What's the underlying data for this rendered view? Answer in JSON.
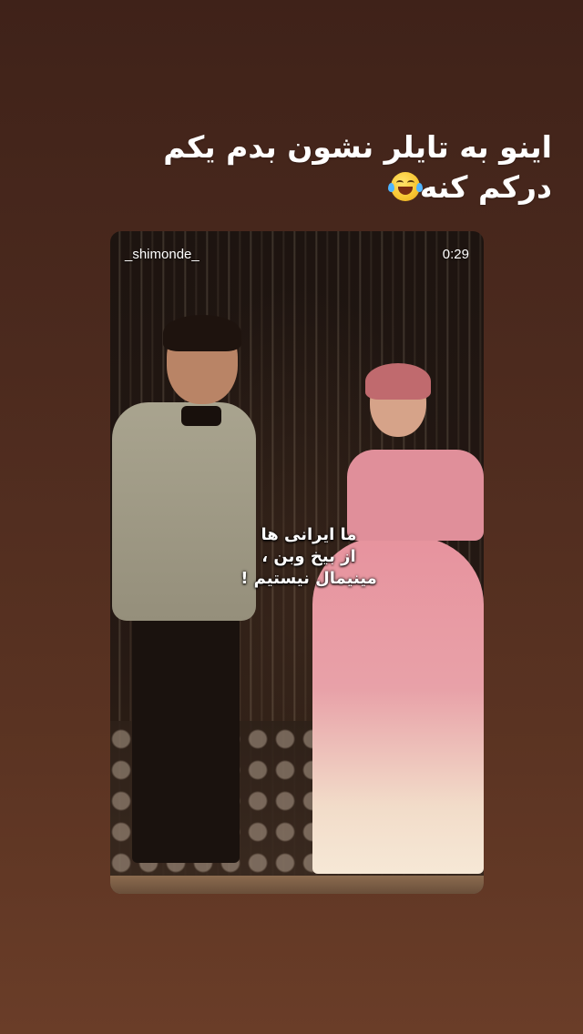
{
  "story": {
    "caption_line1": "اینو به تایلر نشون بدم یکم",
    "caption_line2": "درکم کنه",
    "caption_emoji": "face-with-tears-of-joy-icon"
  },
  "shared_post": {
    "username": "_shimonde_",
    "duration": "0:29",
    "overlay_lines": [
      "ما ایرانی ها",
      "از بیخ وبن ،",
      "مینیمال نیستیم !"
    ]
  },
  "colors": {
    "background_top": "#3f2219",
    "background_bottom": "#6a3d28",
    "text": "#ffffff"
  }
}
